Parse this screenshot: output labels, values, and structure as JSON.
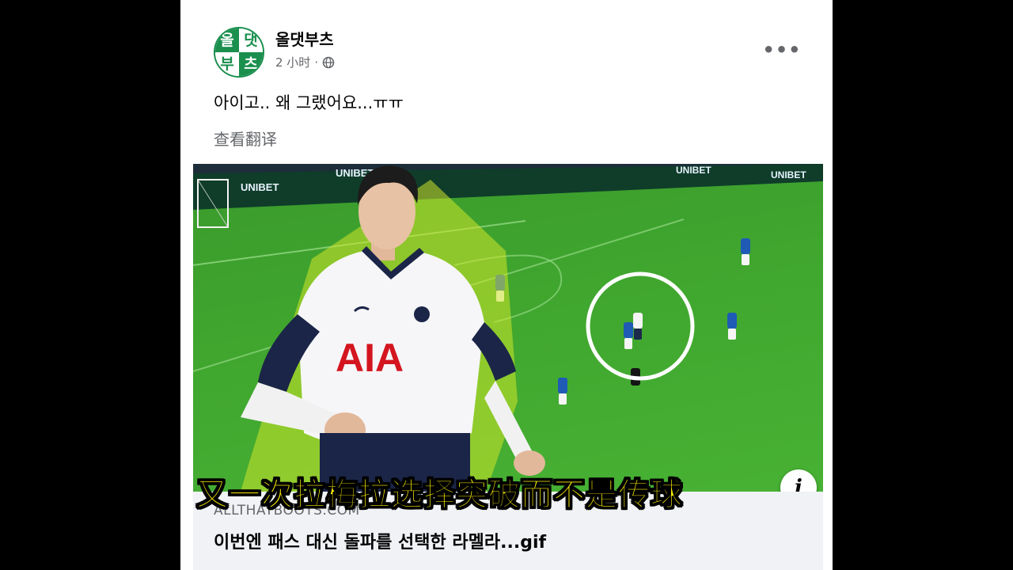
{
  "post": {
    "page_name": "올댓부츠",
    "time_label": "2 小时",
    "separator": "·",
    "more_label": "•••",
    "text": "아이고.. 왜 그랬어요...ㅠㅠ",
    "see_translation": "查看翻译"
  },
  "avatar": {
    "chars": [
      "올",
      "댓",
      "부",
      "츠"
    ]
  },
  "media": {
    "board_texts": [
      "UNIBET",
      "UNIBET",
      "UNIBET",
      "UNIBET"
    ],
    "shirt_sponsor": "AIA",
    "info_icon": "i"
  },
  "subtitle": "又一次拉梅拉选择突破而不是传球",
  "link_preview": {
    "domain": "ALLTHATBOOTS.COM",
    "title": "이번엔 패스 대신 돌파를 선택한 라멜라...gif"
  },
  "colors": {
    "page_background": "#000000",
    "card_background": "#ffffff",
    "brand_green": "#1a8f4e",
    "pitch_green": "#3fa52e",
    "subtitle_yellow": "#fff200",
    "secondary_text": "#65676b"
  },
  "icons": {
    "globe": "globe-icon",
    "more": "more-options-icon",
    "info": "info-icon"
  }
}
